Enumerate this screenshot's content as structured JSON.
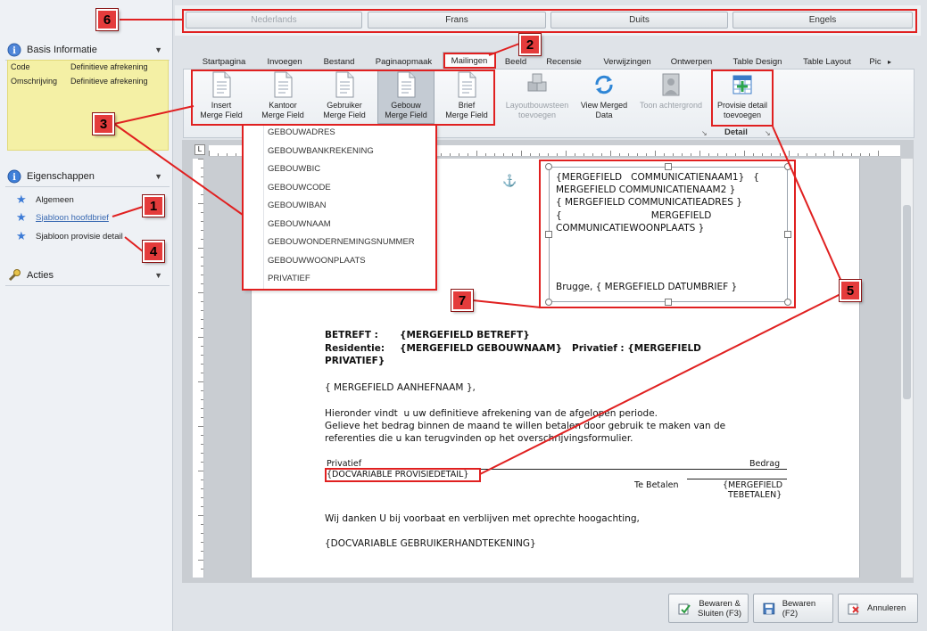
{
  "languages": [
    {
      "label": "Nederlands",
      "enabled": false
    },
    {
      "label": "Frans",
      "enabled": true
    },
    {
      "label": "Duits",
      "enabled": true
    },
    {
      "label": "Engels",
      "enabled": true
    }
  ],
  "sidebar": {
    "basis": {
      "title": "Basis Informatie",
      "rows": [
        {
          "key": "Code",
          "value": "Definitieve afrekening"
        },
        {
          "key": "Omschrijving",
          "value": "Definitieve afrekening"
        }
      ]
    },
    "eigenschappen": {
      "title": "Eigenschappen",
      "items": [
        {
          "label": "Algemeen",
          "link": false
        },
        {
          "label": "Sjabloon hoofdbrief",
          "link": true
        },
        {
          "label": "Sjabloon provisie detail",
          "link": false
        }
      ]
    },
    "acties": {
      "title": "Acties"
    }
  },
  "tabs": [
    "Startpagina",
    "Invoegen",
    "Bestand",
    "Paginaopmaak",
    "Mailingen",
    "Beeld",
    "Recensie",
    "Verwijzingen",
    "Ontwerpen",
    "Table Design",
    "Table Layout",
    "Pic"
  ],
  "active_tab": "Mailingen",
  "ribbon": {
    "merge_buttons": [
      {
        "line1": "Insert",
        "line2": "Merge Field"
      },
      {
        "line1": "Kantoor",
        "line2": "Merge Field"
      },
      {
        "line1": "Gebruiker",
        "line2": "Merge Field"
      },
      {
        "line1": "Gebouw",
        "line2": "Merge Field"
      },
      {
        "line1": "Brief",
        "line2": "Merge Field"
      }
    ],
    "other_buttons": [
      {
        "line1": "Layoutbouwsteen",
        "line2": "toevoegen"
      },
      {
        "line1": "View Merged",
        "line2": "Data"
      },
      {
        "line1": "Toon achtergrond",
        "line2": ""
      }
    ],
    "detail_button": {
      "line1": "Provisie detail",
      "line2": "toevoegen"
    },
    "detail_group": "Detail"
  },
  "dropdown": [
    "GEBOUWADRES",
    "GEBOUWBANKREKENING",
    "GEBOUWBIC",
    "GEBOUWCODE",
    "GEBOUWIBAN",
    "GEBOUWNAAM",
    "GEBOUWONDERNEMINGSNUMMER",
    "GEBOUWWOONPLAATS",
    "PRIVATIEF"
  ],
  "document": {
    "address_lines": [
      "{MERGEFIELD   COMMUNICATIENAAM1}   {",
      "MERGEFIELD COMMUNICATIENAAM2 }",
      "{ MERGEFIELD COMMUNICATIEADRES }",
      "{                              MERGEFIELD",
      "COMMUNICATIEWOONPLAATS }"
    ],
    "date_line": "Brugge, { MERGEFIELD DATUMBRIEF }",
    "betreft_label": "BETREFT :",
    "betreft_value": "{MERGEFIELD BETREFT}",
    "residentie_label": "Residentie:",
    "residentie_value": "{MERGEFIELD GEBOUWNAAM}   Privatief : {MERGEFIELD",
    "residentie_cont": "PRIVATIEF}",
    "aanhef": "{ MERGEFIELD AANHEFNAAM },",
    "body1": "Hieronder vindt  u uw definitieve afrekening van de afgelopen periode.",
    "body2": "Gelieve het bedrag binnen de maand te willen betalen door gebruik te maken van de",
    "body3": "referenties die u kan terugvinden op het overschrijvingsformulier.",
    "col_privatief": "Privatief",
    "col_bedrag": "Bedrag",
    "docvar": "{DOCVARIABLE PROVISIEDETAIL}",
    "te_betalen": "Te Betalen",
    "tebetalen_field1": "{MERGEFIELD",
    "tebetalen_field2": "TEBETALEN}",
    "closing": "Wij danken U bij voorbaat en verblijven met oprechte hoogachting,",
    "signature": "{DOCVARIABLE GEBRUIKERHANDTEKENING}"
  },
  "footer": {
    "save_close_l1": "Bewaren &",
    "save_close_l2": "Sluiten (F3)",
    "save": "Bewaren (F2)",
    "cancel": "Annuleren"
  },
  "callouts": [
    "1",
    "2",
    "3",
    "4",
    "5",
    "6",
    "7"
  ],
  "colors": {
    "callout": "#e43b3b",
    "highlight_panel": "#f4f0a5",
    "accent_blue": "#3b6bb3"
  }
}
